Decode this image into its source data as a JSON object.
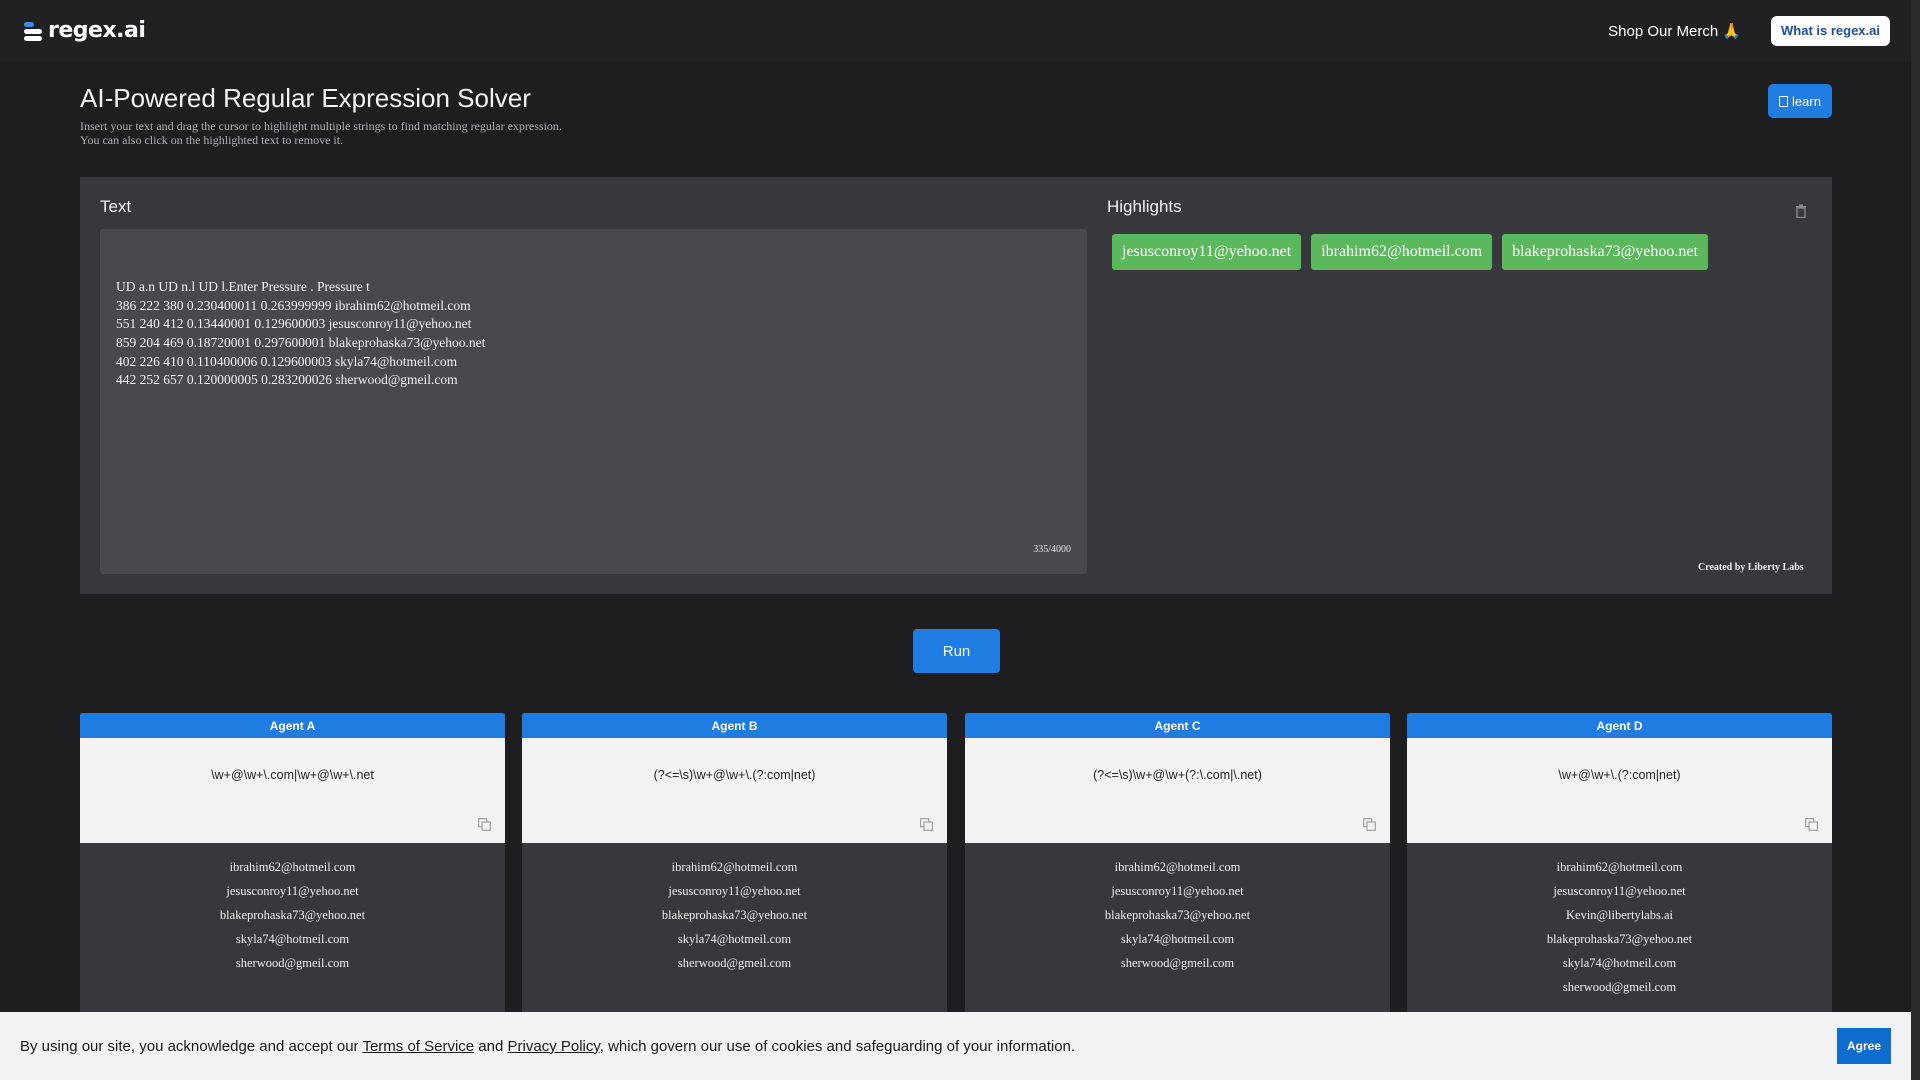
{
  "header": {
    "logo_text": "regex.ai",
    "merch_label": "Shop Our Merch 🙏",
    "what_label": "What is regex.ai"
  },
  "page": {
    "title": "AI-Powered Regular Expression Solver",
    "subtitle_line1": "Insert your text and drag the cursor to highlight multiple strings to find matching regular expression.",
    "subtitle_line2": "You can also click on the highlighted text to remove it.",
    "learn_label": "learn"
  },
  "panel": {
    "text_label": "Text",
    "highlights_label": "Highlights",
    "text_value": "UD a.n UD n.l UD l.Enter Pressure . Pressure t\n386 222 380 0.230400011 0.263999999 ibrahim62@hotmeil.com\n551 240 412 0.13440001 0.129600003 jesusconroy11@yehoo.net\n859 204 469 0.18720001 0.297600001 blakeprohaska73@yehoo.net\n402 226 410 0.110400006 0.129600003 skyla74@hotmeil.com\n442 252 657 0.120000005 0.283200026 sherwood@gmeil.com",
    "counter": "335/4000",
    "highlights": [
      "jesusconroy11@yehoo.net",
      "ibrahim62@hotmeil.com",
      "blakeprohaska73@yehoo.net"
    ],
    "credit": "Created by Liberty Labs"
  },
  "run_label": "Run",
  "agents": [
    {
      "name": "Agent A",
      "regex": "\\w+@\\w+\\.com|\\w+@\\w+\\.net",
      "matches": [
        "ibrahim62@hotmeil.com",
        "jesusconroy11@yehoo.net",
        "blakeprohaska73@yehoo.net",
        "skyla74@hotmeil.com",
        "sherwood@gmeil.com"
      ]
    },
    {
      "name": "Agent B",
      "regex": "(?<=\\s)\\w+@\\w+\\.(?:com|net)",
      "matches": [
        "ibrahim62@hotmeil.com",
        "jesusconroy11@yehoo.net",
        "blakeprohaska73@yehoo.net",
        "skyla74@hotmeil.com",
        "sherwood@gmeil.com"
      ]
    },
    {
      "name": "Agent C",
      "regex": "(?<=\\s)\\w+@\\w+(?:\\.com|\\.net)",
      "matches": [
        "ibrahim62@hotmeil.com",
        "jesusconroy11@yehoo.net",
        "blakeprohaska73@yehoo.net",
        "skyla74@hotmeil.com",
        "sherwood@gmeil.com"
      ]
    },
    {
      "name": "Agent D",
      "regex": "\\w+@\\w+\\.(?:com|net)",
      "matches": [
        "ibrahim62@hotmeil.com",
        "jesusconroy11@yehoo.net",
        "Kevin@libertylabs.ai",
        "blakeprohaska73@yehoo.net",
        "skyla74@hotmeil.com",
        "sherwood@gmeil.com"
      ]
    }
  ],
  "cookie": {
    "prefix": "By using our site, you acknowledge and accept our ",
    "terms": "Terms of Service",
    "middle": " and ",
    "privacy": "Privacy Policy",
    "suffix": ", which govern our use of cookies and safeguarding of your information.",
    "agree_label": "Agree"
  },
  "colors": {
    "accent": "#1f7ce0",
    "chip_green": "#5cb85c",
    "background": "#1e1e20",
    "panel": "#38383c"
  }
}
